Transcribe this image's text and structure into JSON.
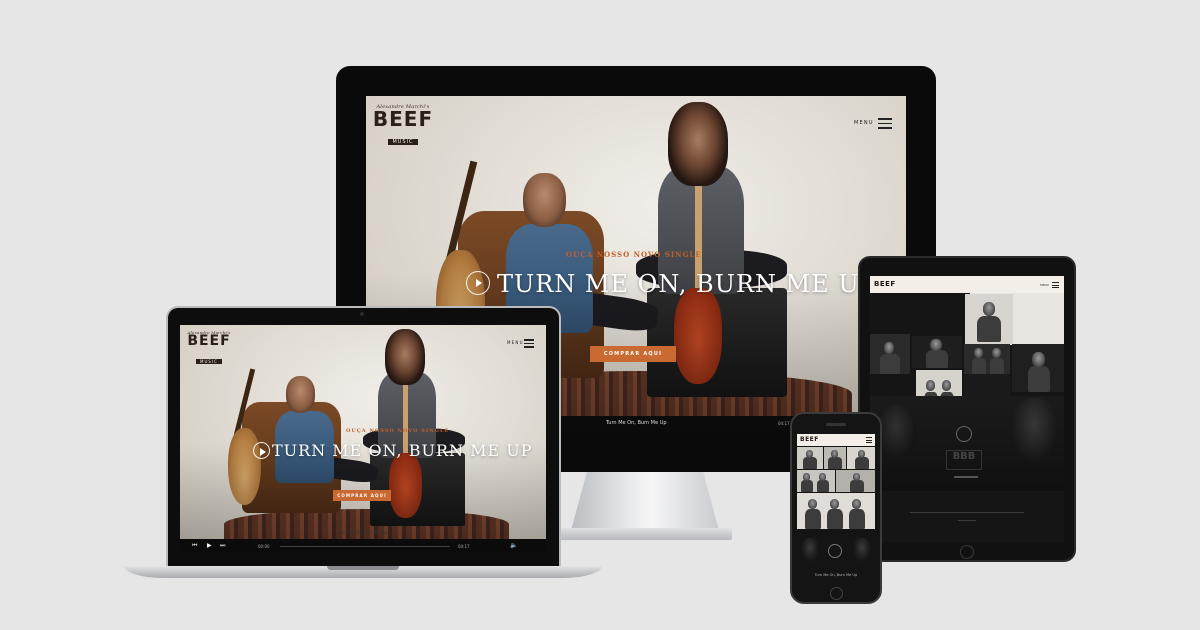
{
  "desktop": {
    "logo_script": "Alexandre Marchi's",
    "logo_main": "BEEF",
    "logo_sub": "MUSIC",
    "menu_label": "MENU",
    "kicker": "OUÇA NOSSO NOVO SINGLE",
    "headline": "TURN ME ON, BURN ME UP",
    "cta": "COMPRAR AQUI",
    "player_title": "Turn Me On, Burn Me Up",
    "player_time": "04:17"
  },
  "laptop": {
    "logo_script": "Alexandre Marchi's",
    "logo_main": "BEEF",
    "logo_sub": "MUSIC",
    "menu_label": "MENU",
    "kicker": "OUÇA NOSSO NOVO SINGLE",
    "headline": "TURN ME ON, BURN ME UP",
    "cta": "COMPRAR AQUI",
    "player_title": "Turn Me On, Burn Me Up",
    "player_elapsed": "00:00",
    "player_time": "04:17"
  },
  "tablet": {
    "logo_main": "BEEF",
    "menu_label": "MENU"
  },
  "phone": {
    "logo_main": "BEEF",
    "player_title": "Turn Me On, Burn Me Up"
  },
  "colors": {
    "accent": "#c96a32",
    "background": "#e6e6e6",
    "bezel": "#0a0a0a"
  }
}
